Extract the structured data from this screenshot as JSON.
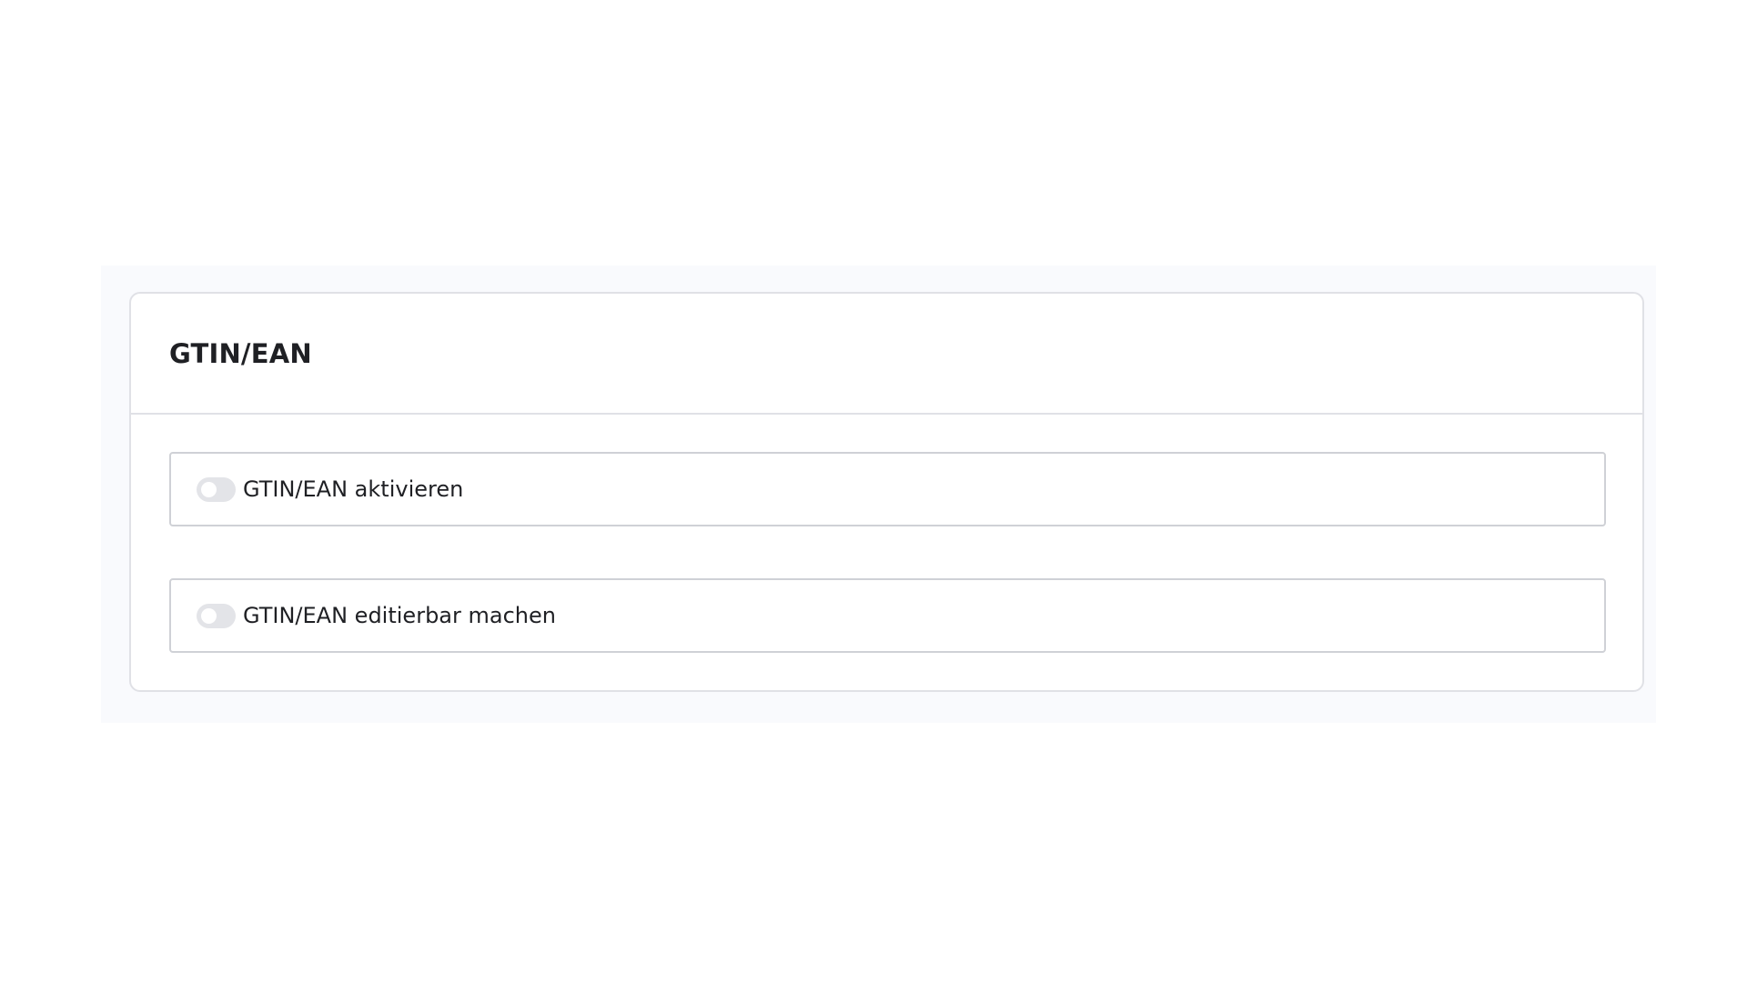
{
  "section": {
    "title": "GTIN/EAN",
    "toggles": [
      {
        "label": "GTIN/EAN aktivieren",
        "checked": false
      },
      {
        "label": "GTIN/EAN editierbar machen",
        "checked": false
      }
    ]
  },
  "colors": {
    "panel_background": "#f9fafd",
    "card_border": "#e0e1e6",
    "row_border": "#cfd1d6",
    "switch_off": "#e3e4e8",
    "text": "#1f2024"
  }
}
